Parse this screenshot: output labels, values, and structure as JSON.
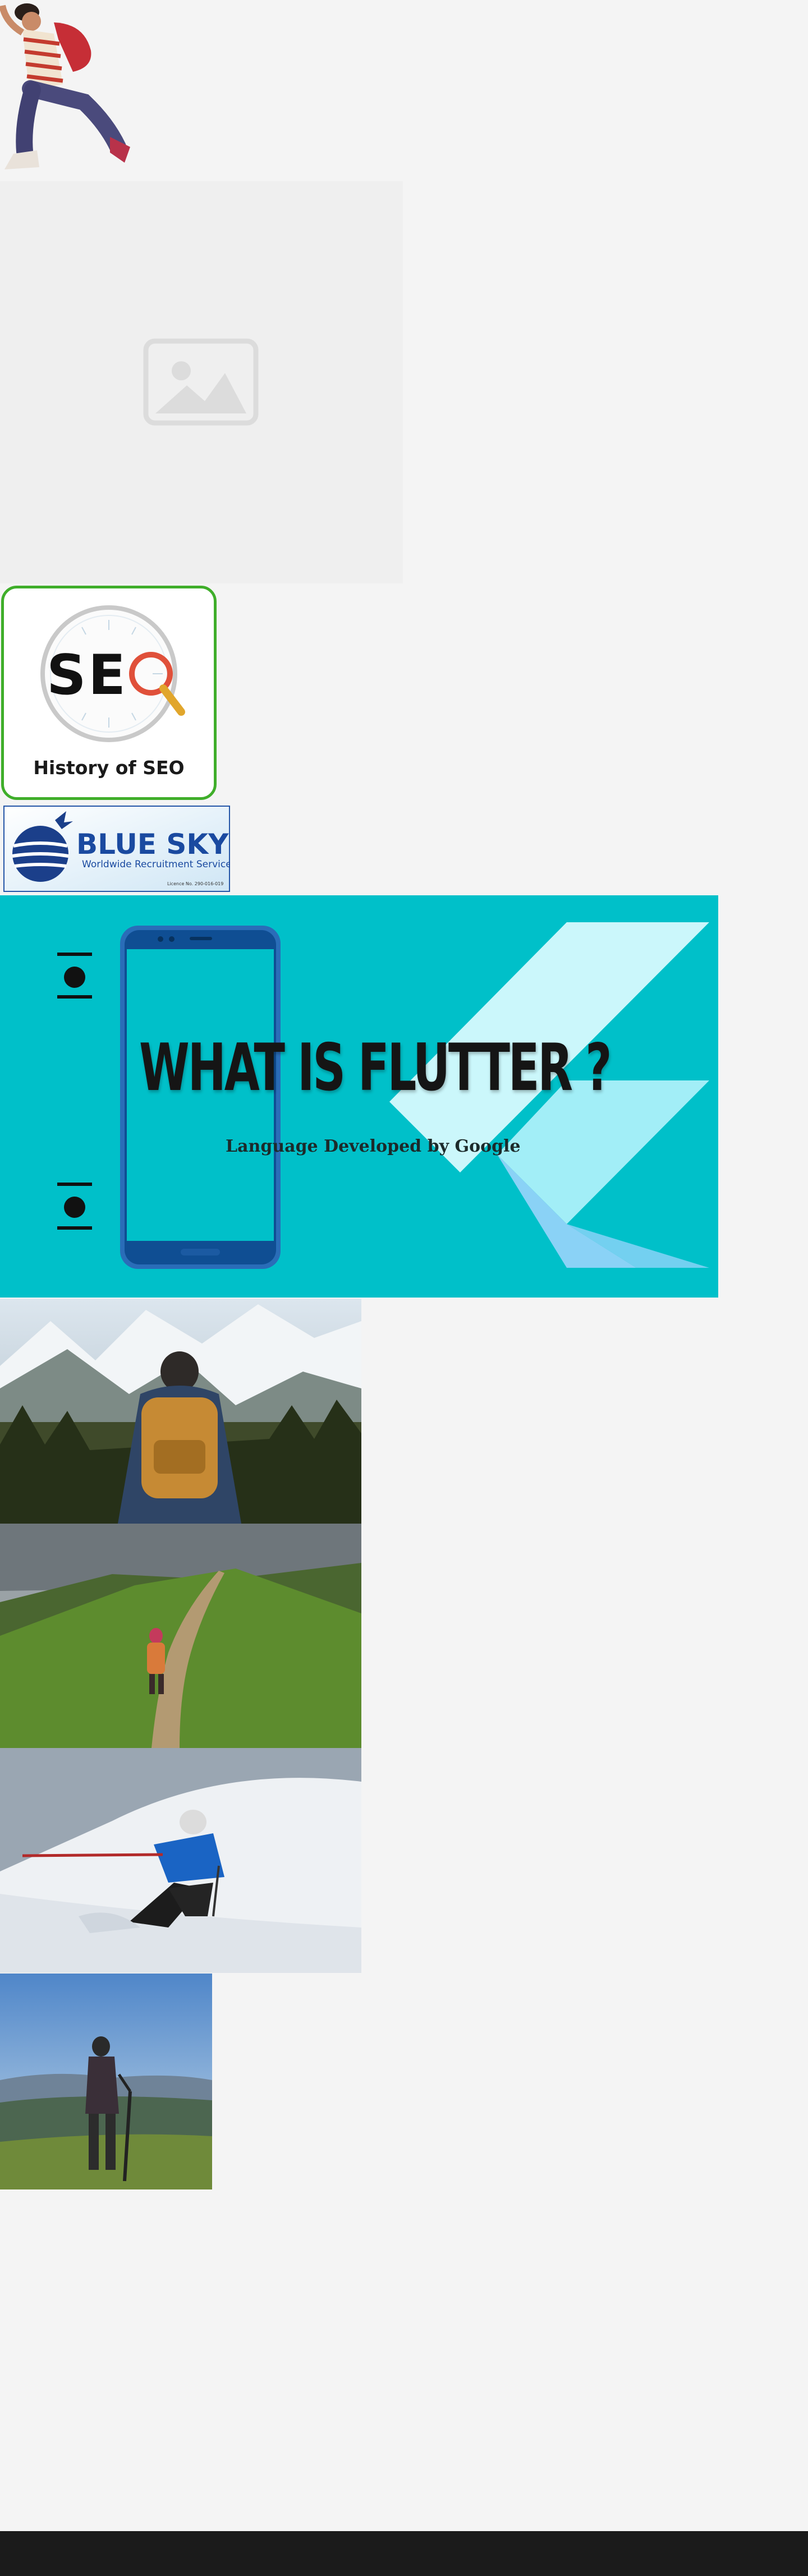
{
  "cards": {
    "seo_caption": "History of SEO"
  },
  "banners": {
    "bluesky_title": "BLUE SKY",
    "bluesky_tagline": "Worldwide Recruitment Services",
    "bluesky_license": "Licence No. 290-016-019",
    "flutter_title": "WHAT IS FLUTTER ?",
    "flutter_subtitle": "Language Developed by Google"
  },
  "icons": {
    "placeholder": "image-placeholder-icon",
    "seo_clock": "clock-icon",
    "seo_magnifier": "magnifier-icon",
    "bluesky_logo": "globe-icon"
  },
  "colors": {
    "page_bg": "#f4f4f4",
    "seo_border": "#3fae2a",
    "flutter_bg": "#00c0c9",
    "bluesky_blue": "#1a4aa0",
    "footer_bg": "#1b1b1b"
  }
}
